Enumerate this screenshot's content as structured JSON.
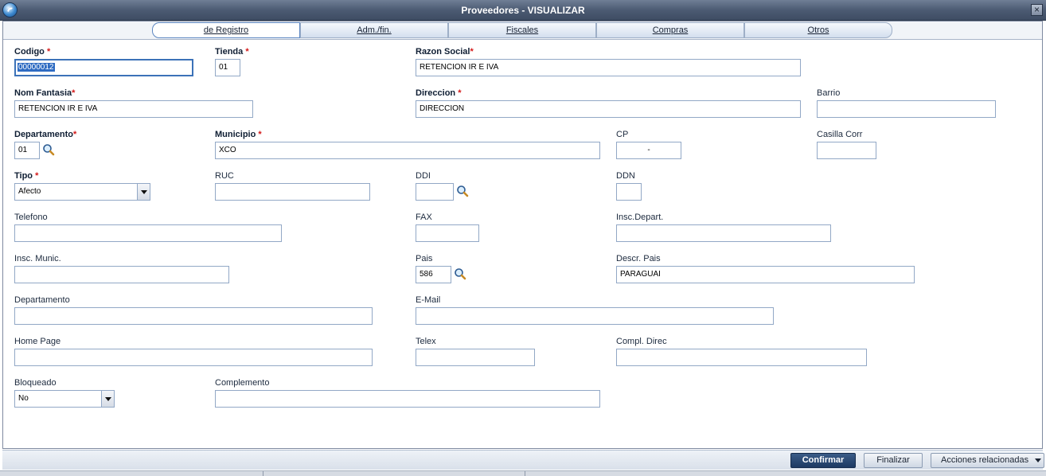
{
  "window": {
    "title": "Proveedores - VISUALIZAR",
    "close_glyph": "×"
  },
  "tabs": [
    {
      "label": "de Registro"
    },
    {
      "label": "Adm./fin."
    },
    {
      "label": "Fiscales"
    },
    {
      "label": "Compras"
    },
    {
      "label": "Otros"
    }
  ],
  "fields": {
    "codigo": {
      "label": "Codigo",
      "value": "00000012"
    },
    "tienda": {
      "label": "Tienda",
      "value": "01"
    },
    "razon_social": {
      "label": "Razon Social",
      "value": "RETENCION IR E IVA"
    },
    "nom_fantasia": {
      "label": "Nom Fantasia",
      "value": "RETENCION IR E IVA"
    },
    "direccion": {
      "label": "Direccion",
      "value": "DIRECCION"
    },
    "barrio": {
      "label": "Barrio",
      "value": ""
    },
    "departamento_req": {
      "label": "Departamento",
      "value": "01"
    },
    "municipio": {
      "label": "Municipio",
      "value": "XCO"
    },
    "cp": {
      "label": "CP",
      "value": "-"
    },
    "casilla_corr": {
      "label": "Casilla Corr",
      "value": ""
    },
    "tipo": {
      "label": "Tipo",
      "value": "Afecto"
    },
    "ruc": {
      "label": "RUC",
      "value": ""
    },
    "ddi": {
      "label": "DDI",
      "value": ""
    },
    "ddn": {
      "label": "DDN",
      "value": ""
    },
    "telefono": {
      "label": "Telefono",
      "value": ""
    },
    "fax": {
      "label": "FAX",
      "value": ""
    },
    "insc_depart": {
      "label": "Insc.Depart.",
      "value": ""
    },
    "insc_munic": {
      "label": "Insc. Munic.",
      "value": ""
    },
    "pais": {
      "label": "Pais",
      "value": "586"
    },
    "descr_pais": {
      "label": "Descr. Pais",
      "value": "PARAGUAI"
    },
    "departamento": {
      "label": "Departamento",
      "value": ""
    },
    "email": {
      "label": "E-Mail",
      "value": ""
    },
    "home_page": {
      "label": "Home Page",
      "value": ""
    },
    "telex": {
      "label": "Telex",
      "value": ""
    },
    "compl_direc": {
      "label": "Compl. Direc",
      "value": ""
    },
    "bloqueado": {
      "label": "Bloqueado",
      "value": "No"
    },
    "complemento": {
      "label": "Complemento",
      "value": ""
    }
  },
  "required_mark": "*",
  "footer": {
    "confirm_label": "Confirmar",
    "finish_label": "Finalizar",
    "actions_label": "Acciones relacionadas"
  },
  "colors": {
    "title_bar": "#4c5b73",
    "accent": "#2e6bc2",
    "required": "#d31818",
    "primary_button": "#1d3a63"
  }
}
